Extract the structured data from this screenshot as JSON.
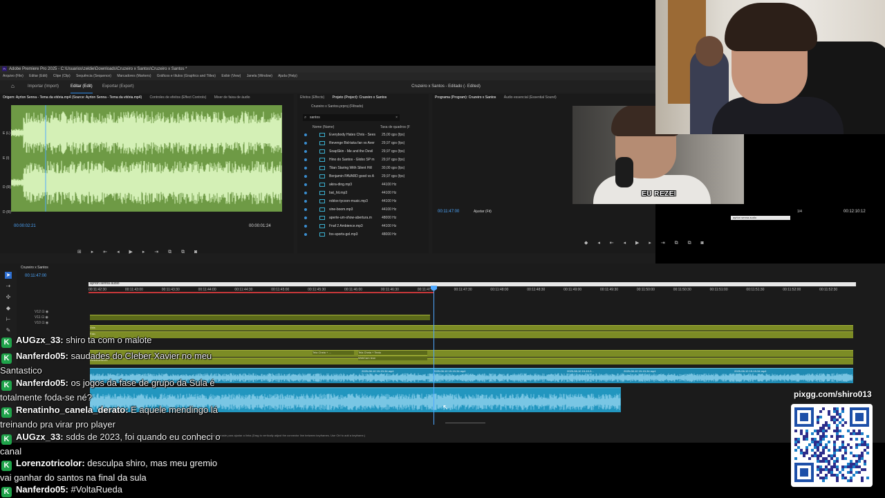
{
  "window": {
    "title": "Adobe Premiere Pro 2025 - C:\\Usuarios\\zeldie\\Downloads\\Cruzeiro x Santos\\Cruzeiro x Santos *",
    "menus": [
      "Arquivo (File)",
      "Editar (Edit)",
      "Clipe (Clip)",
      "Sequência (Sequence)",
      "Marcadores (Markers)",
      "Gráficos e títulos (Graphics and Titles)",
      "Exibir (View)",
      "Janela (Window)",
      "Ajuda (Help)"
    ]
  },
  "header": {
    "workspaces": [
      "Importar (Import)",
      "Editar (Edit)",
      "Exportar (Export)"
    ],
    "project_title": "Cruzeiro x Santos - Editado (- Edited)"
  },
  "source": {
    "tabs": [
      "Origem: Ayrton Senna - Tema da vitória.mp4 (Source: Ayrton Senna - Tema da vitória.mp4)",
      "Controles de efeitos (Effect Controls)",
      "Mixer de faixa de áudio"
    ],
    "channel_labels": [
      "E (L)",
      "E (I)",
      "D (R)",
      "D (R)"
    ],
    "timecode": "00:00:02:21",
    "duration": "00:00:01:24"
  },
  "project": {
    "tabs": [
      "Efeitos (Effects)",
      "Projeto (Project): Cruzeiro x Santos"
    ],
    "path": "Cruzeiro x Santos.prproj (Filtrado)",
    "search_value": "santos",
    "col_name": "Nome (Name)",
    "col_rate": "Taxa de quadros (F",
    "items": [
      {
        "name": "Everybody Hates Chris - Sees",
        "rate": "25,00 qps (fps)"
      },
      {
        "name": "Revenge Bid-taka fan vs Aver",
        "rate": "29,97 qps (fps)"
      },
      {
        "name": "SoapSkin - Me and the Devil",
        "rate": "29,97 qps (fps)"
      },
      {
        "name": "Hino do Santos - Globo SP m",
        "rate": "29,97 qps (fps)"
      },
      {
        "name": "Titan Staring With Silent Hill",
        "rate": "30,00 qps (fps)"
      },
      {
        "name": "Benjamin PAVARD good vs A",
        "rate": "29,97 qps (fps)"
      },
      {
        "name": "akira-ding.mp3",
        "rate": "44100 Hz"
      },
      {
        "name": "bat_hit.mp3",
        "rate": "44100 Hz"
      },
      {
        "name": "roblox-tycoon-music.mp3",
        "rate": "44100 Hz"
      },
      {
        "name": "vine-boom.mp3",
        "rate": "44100 Hz"
      },
      {
        "name": "aperte-um-show-abertura.m",
        "rate": "48000 Hz"
      },
      {
        "name": "Fnaf 2 Ambience.mp3",
        "rate": "44100 Hz"
      },
      {
        "name": "fox-sports-gol.mp3",
        "rate": "48000 Hz"
      }
    ]
  },
  "program": {
    "tabs": [
      "Programa (Program): Cruzeiro x Santos",
      "Áudio essencial (Essential Sound)"
    ],
    "timecode": "00:11:47:00",
    "fit": "Ajustar (Fit)",
    "scale": "1/4",
    "duration": "00:12:10:12",
    "caption": "EU REZEI",
    "marker_label": "ayrton senna audio"
  },
  "timeline": {
    "sequence_tab": "Cruzeiro x Santos",
    "timecode": "00:11:47:00",
    "selection_label": "ayrton senna audio",
    "ruler": [
      "00:11:42:30",
      "00:11:43:00",
      "00:11:43:30",
      "00:11:44:00",
      "00:11:44:30",
      "00:11:45:00",
      "00:11:45:30",
      "00:11:46:00",
      "00:11:46:30",
      "00:11:47:00",
      "00:11:47:30",
      "00:11:48:00",
      "00:11:48:30",
      "00:11:49:00",
      "00:11:49:30",
      "00:11:50:00",
      "00:11:50:30",
      "00:11:51:00",
      "00:11:51:30",
      "00:11:52:00",
      "00:11:52:30"
    ],
    "tracks": [
      "V12",
      "V11",
      "V10"
    ],
    "clip_labels": {
      "vids": "Vids",
      "falo": "Falo",
      "deslocamento": "Deslocamento",
      "tela_cheia": "Tela Cheia + ...",
      "tela_cheia_texto": "Tela Cheia + Texto",
      "webcam": "WebCam leon",
      "a1": "2025-08-10 19-19-34.mp4",
      "a2": "2025-08-10 19-19-34.mp4",
      "a3": "2025-08-10 19-10-3...",
      "a4": "2025-08-10 19-19-34.mp4",
      "a5": "2025-08-10 19-19-34.mp4"
    },
    "status": "Clique e arraste para ajustar a linha (Drag to vertically adjust the connector line between keyframes. Use Ctrl to add a keyframe.)"
  },
  "chat": [
    {
      "user": "AUGzx_33:",
      "message": "shiro ta com o malote"
    },
    {
      "user": "Nanferdo05:",
      "message": "saudades do Cleber Xavier no meu Santastico"
    },
    {
      "user": "Nanferdo05:",
      "message": "os jogos da fase de grupo da Sula é totalmente foda-se né?"
    },
    {
      "user": "Renatinho_canela_derato:",
      "message": "E aquele mendingo lá treinando pra virar pro player"
    },
    {
      "user": "AUGzx_33:",
      "message": "sdds de 2023, foi quando eu conheci o canal"
    },
    {
      "user": "Lorenzotricolor:",
      "message": "desculpa shiro, mas meu gremio vai ganhar do santos na final da sula"
    },
    {
      "user": "Nanferdo05:",
      "message": "#VoltaRueda"
    }
  ],
  "qr": {
    "label": "pixgg.com/shiro013"
  },
  "colors": {
    "premiere_bg": "#1d1d1d",
    "audio_waveform_bg": "#6e9a45",
    "video_clip": "#7c8c25",
    "audio_clip": "#1f8ab2",
    "playhead": "#4ea8ff",
    "chat_badge": "#1fa34a"
  }
}
